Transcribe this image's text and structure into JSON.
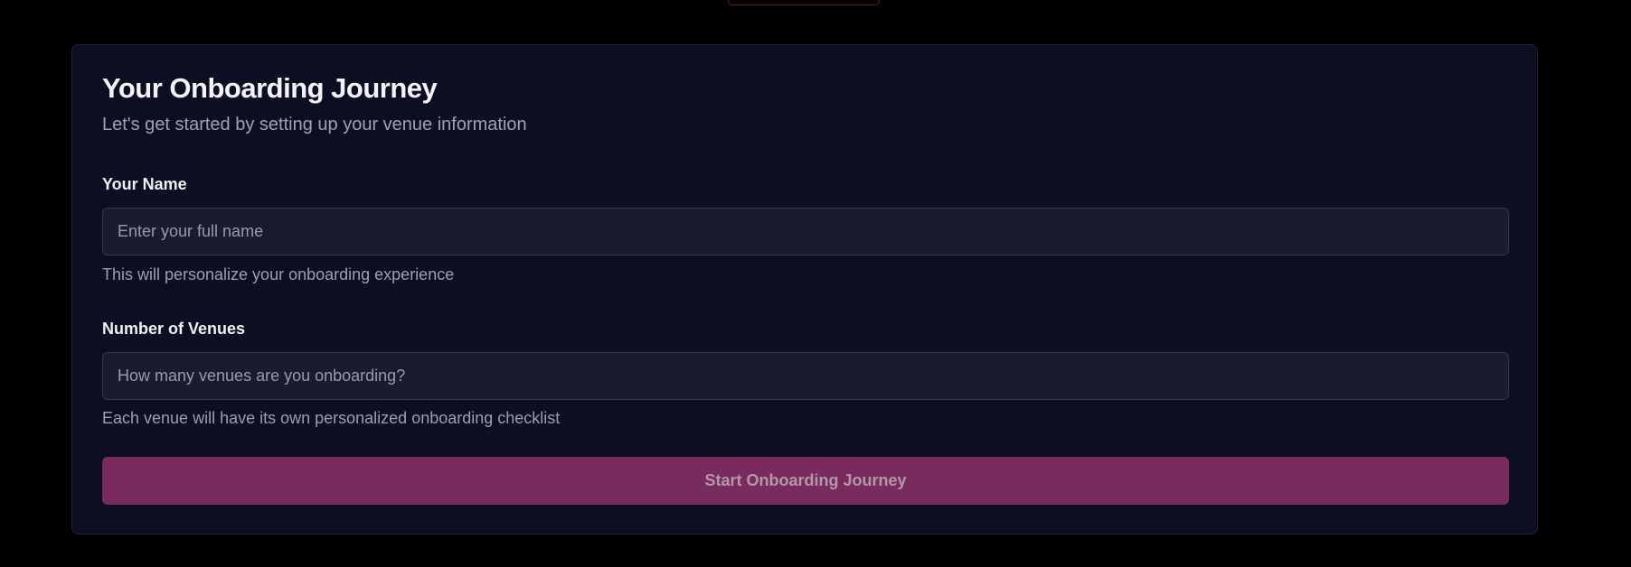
{
  "onboarding": {
    "title": "Your Onboarding Journey",
    "subtitle": "Let's get started by setting up your venue information",
    "name_field": {
      "label": "Your Name",
      "placeholder": "Enter your full name",
      "value": "",
      "help": "This will personalize your onboarding experience"
    },
    "venues_field": {
      "label": "Number of Venues",
      "placeholder": "How many venues are you onboarding?",
      "value": "",
      "help": "Each venue will have its own personalized onboarding checklist"
    },
    "submit_label": "Start Onboarding Journey"
  },
  "colors": {
    "page_background": "#000000",
    "card_background": "#0d0e22",
    "input_background": "#1a1b2c",
    "accent": "#782b5c"
  }
}
